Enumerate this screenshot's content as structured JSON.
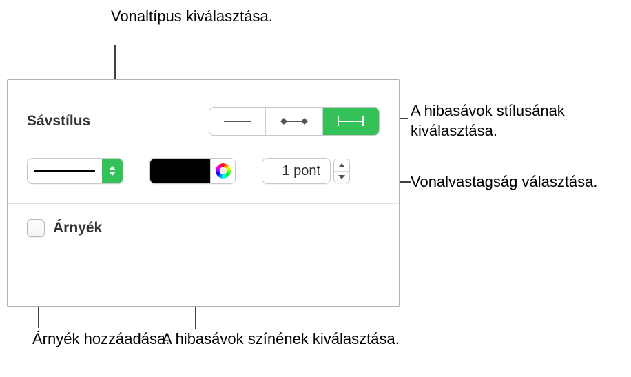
{
  "callouts": {
    "linetype": "Vonaltípus kiválasztása.",
    "barstyle": "A hibasávok stílusának kiválasztása.",
    "thickness": "Vonalvastagság választása.",
    "color": "A hibasávok színének kiválasztása.",
    "shadow": "Árnyék hozzáadása."
  },
  "panel": {
    "section_label": "Sávstílus",
    "shadow_label": "Árnyék",
    "stepper_value": "1 pont",
    "color_swatch": "#000000",
    "accent": "#34c158",
    "bar_style_selected_index": 2
  }
}
